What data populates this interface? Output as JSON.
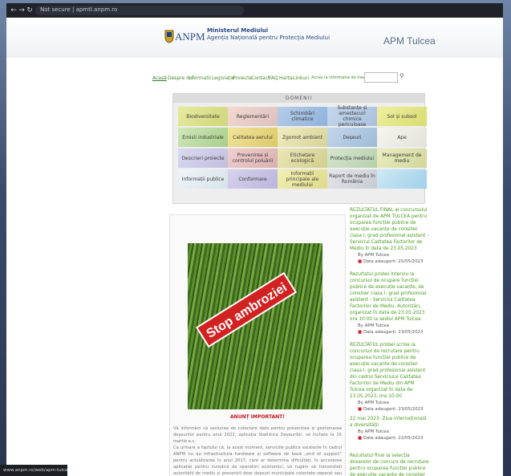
{
  "browser": {
    "address": "Not secure | apmtl.anpm.ro"
  },
  "header": {
    "logo_text": "ANPM",
    "ministry_line1": "Ministerul Mediului",
    "ministry_line2": "Agenția Națională pentru Protecția Mediului",
    "site_title": "APM Tulcea"
  },
  "menu": [
    "Acasă",
    "Despre noi",
    "Informatii",
    "Legislație",
    "Proiecte",
    "Contact",
    "FAQ",
    "Harta",
    "Linkuri",
    "Acces la informatia de mediu"
  ],
  "domains": {
    "title": "DOMENII",
    "tiles": [
      "Biodiversitate",
      "Reglementări",
      "Schimbări climatice",
      "Substanțe și amestecuri chimice periculoase",
      "Sol și subsol",
      "Emisii industriale",
      "Calitatea aerului",
      "Zgomot ambiant",
      "Deșeuri",
      "Ape",
      "Descrieri proiecte",
      "Prevenirea și controlul poluării",
      "Etichetare ecologică",
      "Protecția mediului",
      "Management de mediu",
      "Informații publice",
      "Conformare",
      "Informații principale ale mediului",
      "Raport de mediu în România",
      ""
    ]
  },
  "left_panel": {
    "photo_caption": "Stop ambroziei",
    "anunt_title": "ANUNȚ IMPORTANT!",
    "para1": "Vă informăm că sesiunea de colectare date pentru prevenirea și gestionarea deșeurilor pentru anul 2022, aplicația Statistica Deșeurilor, se încheie la 15 martie a.c.",
    "para2": "Ca urmare a faptului că, la acest moment, serviciile publice existente în cadrul ANPM nu au infrastructura hardware și software de bază „end of support” pentru actualizarea în anul 2017, care ar determina dificultăți, în accesarea aplicației pentru numărul de operatori economici, vă rugăm să transmiteți autorității de mediu și prevenirii doar deșeuri municipale colectate separat sau în amestec de operatori de salubrizare, documentele solicitate fiind necesare pentru raportarea Statistică a Deșeurilor."
  },
  "news": [
    {
      "title": "REZULTATUL FINAL al concursului organizat de APM TULCEA pentru ocuparea funcției publice de execuție vacante de consilier clasa I, grad profesional asistent - Serviciul Calitatea Factorilor de Mediu în data de 23.05.2023",
      "author": "By APM Tulcea",
      "date": "Data adaugarii: 25/05/2023"
    },
    {
      "title": "Rezultatul probei interviu la concursul de ocupare funcției publice de execuție vacante, de consilier clasa I, grad profesional asistent - Serviciul Calitatea Factorilor de Mediu, Autorizări, organizat în data de 23.05.2023 ora 10:00 la sediul APM Tulcea",
      "author": "By APM Tulcea",
      "date": "Data adaugarii: 23/05/2023"
    },
    {
      "title": "REZULTATUL probei scrise la concursul de recrutare pentru ocuparea funcției publice de execuție vacante de consilier clasa I, grad profesional asistent din cadrul Serviciului Calitatea Factorilor de Mediu din APM Tulcea organizat în data de 23.05.2023, ora 10:00",
      "author": "By APM Tulcea",
      "date": "Data adaugarii: 23/05/2023"
    },
    {
      "title": "22 mai 2023: Ziua internațională a diversității",
      "author": "By APM Tulcea",
      "date": "Data adaugarii: 22/05/2023"
    },
    {
      "title": "Rezultatul final la selecția dosarelor de concurs de recrutare pentru ocuparea funcției publice de execuție vacante de consilier clasa I, grad profesional asistent din cadrul Serviciului Calitatea Factorilor de Mediu",
      "author": "",
      "date": ""
    }
  ],
  "status": {
    "text": "www.anpm.ro/web/apm-tulcea/domenii"
  },
  "colors": {
    "accent_green": "#4b9a1e",
    "red": "#c8141b",
    "stamp_red": "#d22121"
  }
}
